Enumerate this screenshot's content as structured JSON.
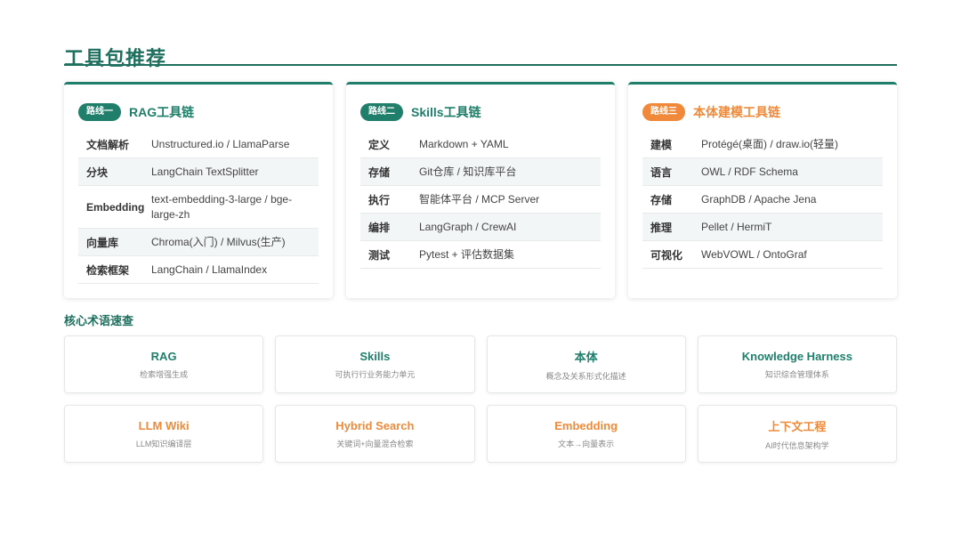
{
  "page": {
    "title": "工具包推荐"
  },
  "routes": [
    {
      "tag": "路线一",
      "title": "RAG工具链",
      "accent": "#1f7f6a",
      "rows": [
        {
          "k": "文档解析",
          "v": "Unstructured.io / LlamaParse"
        },
        {
          "k": "分块",
          "v": "LangChain TextSplitter"
        },
        {
          "k": "Embedding",
          "v": "text-embedding-3-large / bge-large-zh"
        },
        {
          "k": "向量库",
          "v": "Chroma(入门) / Milvus(生产)"
        },
        {
          "k": "检索框架",
          "v": "LangChain / LlamaIndex"
        }
      ]
    },
    {
      "tag": "路线二",
      "title": "Skills工具链",
      "accent": "#1f7f6a",
      "rows": [
        {
          "k": "定义",
          "v": "Markdown + YAML"
        },
        {
          "k": "存储",
          "v": "Git仓库 / 知识库平台"
        },
        {
          "k": "执行",
          "v": "智能体平台 / MCP Server"
        },
        {
          "k": "编排",
          "v": "LangGraph / CrewAI"
        },
        {
          "k": "测试",
          "v": "Pytest + 评估数据集"
        }
      ]
    },
    {
      "tag": "路线三",
      "title": "本体建模工具链",
      "accent": "#f08a3a",
      "rows": [
        {
          "k": "建模",
          "v": "Protégé(桌面) / draw.io(轻量)"
        },
        {
          "k": "语言",
          "v": "OWL / RDF Schema"
        },
        {
          "k": "存储",
          "v": "GraphDB / Apache Jena"
        },
        {
          "k": "推理",
          "v": "Pellet / HermiT"
        },
        {
          "k": "可视化",
          "v": "WebVOWL / OntoGraf"
        }
      ]
    }
  ],
  "glossary": {
    "title": "核心术语速查",
    "terms": [
      {
        "name": "RAG",
        "desc": "检索增强生成",
        "color": "#1f7f6a"
      },
      {
        "name": "Skills",
        "desc": "可执行行业务能力单元",
        "color": "#1f7f6a"
      },
      {
        "name": "本体",
        "desc": "概念及关系形式化描述",
        "color": "#1f7f6a"
      },
      {
        "name": "Knowledge Harness",
        "desc": "知识综合管理体系",
        "color": "#1f7f6a"
      },
      {
        "name": "LLM Wiki",
        "desc": "LLM知识编译层",
        "color": "#f08a3a"
      },
      {
        "name": "Hybrid Search",
        "desc": "关键词+向量混合检索",
        "color": "#f08a3a"
      },
      {
        "name": "Embedding",
        "desc": "文本→向量表示",
        "color": "#f08a3a"
      },
      {
        "name": "上下文工程",
        "desc": "AI时代信息架构学",
        "color": "#f08a3a"
      }
    ]
  }
}
